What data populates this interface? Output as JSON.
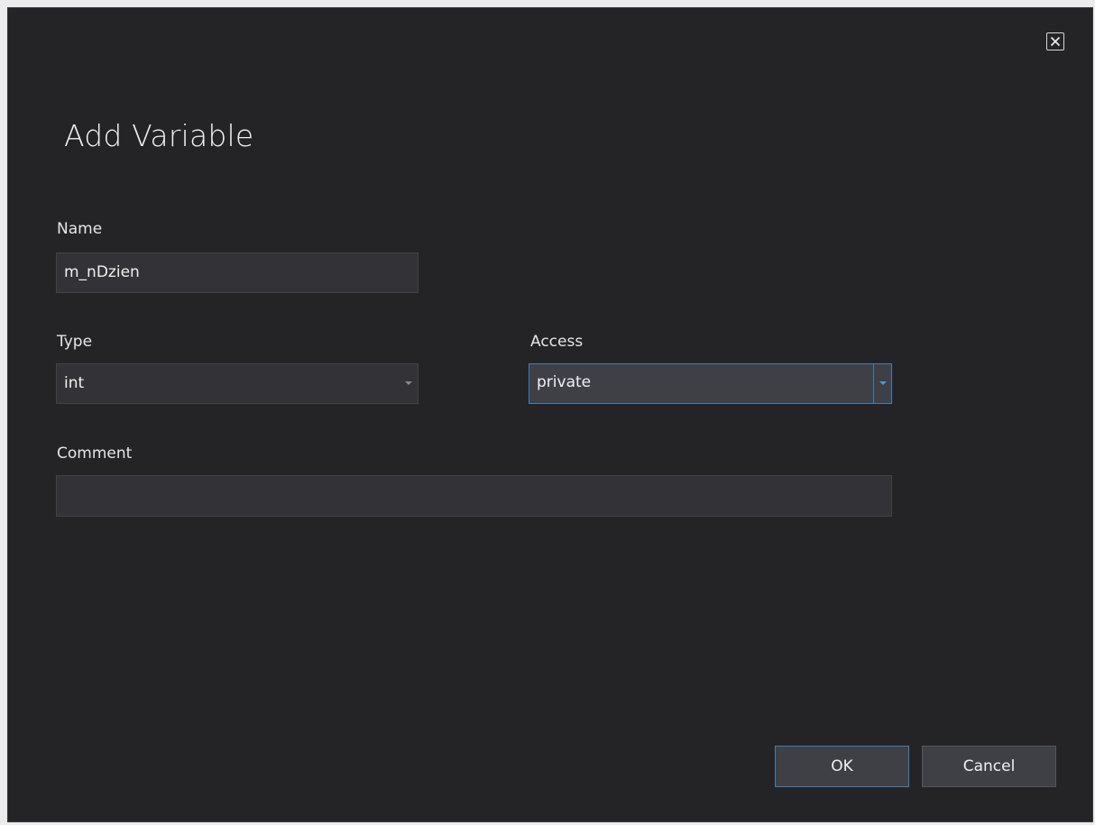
{
  "dialog": {
    "title": "Add Variable",
    "close_icon": "close-box-icon"
  },
  "fields": {
    "name": {
      "label": "Name",
      "value": "m_nDzien"
    },
    "type": {
      "label": "Type",
      "value": "int",
      "icon": "chevron-down-icon"
    },
    "access": {
      "label": "Access",
      "value": "private",
      "icon": "chevron-down-icon"
    },
    "comment": {
      "label": "Comment",
      "value": ""
    }
  },
  "buttons": {
    "ok_label": "OK",
    "cancel_label": "Cancel"
  },
  "colors": {
    "background": "#242427",
    "field_bg": "#333337",
    "accent": "#3e7fb6",
    "text": "#f1f1f1"
  }
}
